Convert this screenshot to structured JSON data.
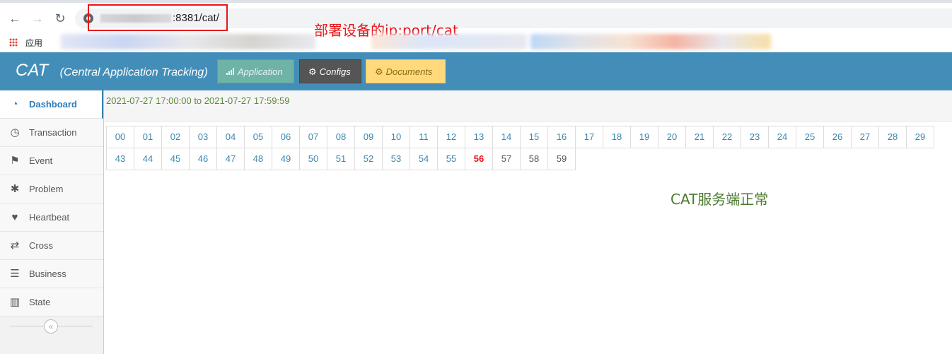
{
  "browser": {
    "url_visible": ":8381/cat/",
    "bookmarks_label": "应用"
  },
  "annotations": {
    "top": "部署设备的ip:port/cat",
    "server_status": "CAT服务端正常"
  },
  "header": {
    "brand": "CAT",
    "subtitle": "(Central Application Tracking)",
    "buttons": [
      {
        "label": "Application",
        "icon": "bar-chart-icon"
      },
      {
        "label": "Configs",
        "icon": "gears-icon"
      },
      {
        "label": "Documents",
        "icon": "gears-icon"
      }
    ]
  },
  "sidebar": {
    "items": [
      {
        "label": "Dashboard",
        "icon": "dashboard-icon",
        "active": true
      },
      {
        "label": "Transaction",
        "icon": "clock-icon"
      },
      {
        "label": "Event",
        "icon": "flag-icon"
      },
      {
        "label": "Problem",
        "icon": "bug-icon"
      },
      {
        "label": "Heartbeat",
        "icon": "heart-icon"
      },
      {
        "label": "Cross",
        "icon": "random-icon"
      },
      {
        "label": "Business",
        "icon": "list-icon"
      },
      {
        "label": "State",
        "icon": "bar-chart-icon"
      }
    ]
  },
  "main": {
    "time_range": "2021-07-27 17:00:00 to 2021-07-27 17:59:59",
    "minutes_row1": [
      "00",
      "01",
      "02",
      "03",
      "04",
      "05",
      "06",
      "07",
      "08",
      "09",
      "10",
      "11",
      "12",
      "13",
      "14",
      "15",
      "16",
      "17",
      "18",
      "19",
      "20",
      "21",
      "22",
      "23",
      "24",
      "25",
      "26",
      "27",
      "28",
      "29"
    ],
    "minutes_row2": [
      "43",
      "44",
      "45",
      "46",
      "47",
      "48",
      "49",
      "50",
      "51",
      "52",
      "53",
      "54",
      "55",
      "56",
      "57",
      "58",
      "59"
    ],
    "current_minute": "56"
  }
}
